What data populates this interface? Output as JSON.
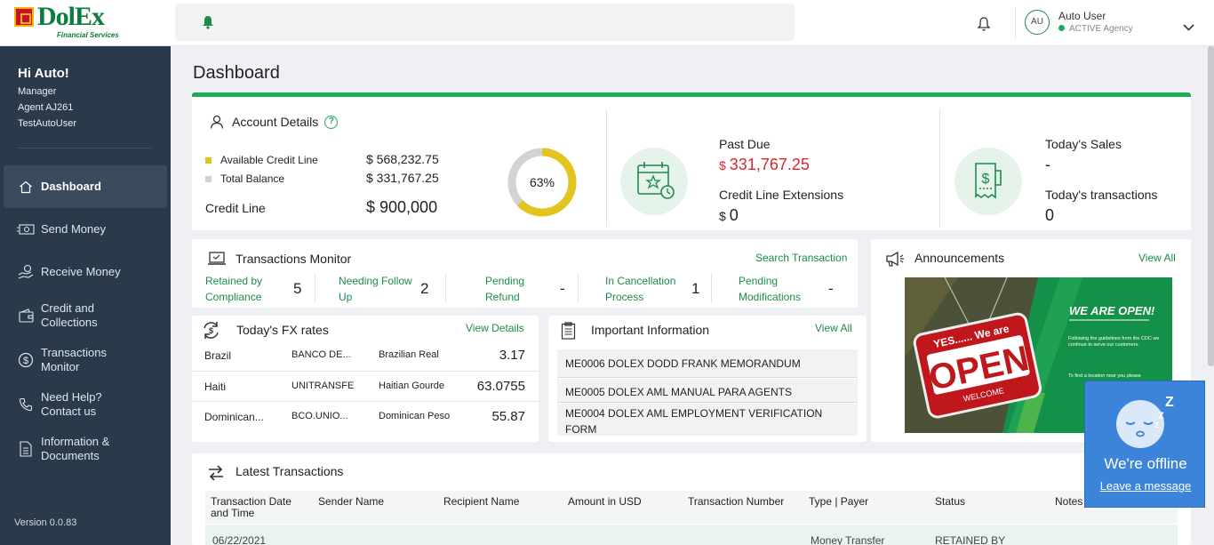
{
  "brand": {
    "name": "DolEx",
    "tagline": "Financial Services"
  },
  "user": {
    "initials": "AU",
    "name": "Auto User",
    "status": "ACTIVE Agency"
  },
  "sidebar": {
    "greeting": "Hi Auto!",
    "role": "Manager",
    "agent": "Agent AJ261",
    "username": "TestAutoUser",
    "items": [
      {
        "label": "Dashboard",
        "icon": "home-icon"
      },
      {
        "label": "Send Money",
        "icon": "money-icon"
      },
      {
        "label": "Receive Money",
        "icon": "hand-money-icon"
      },
      {
        "label": "Credit and Collections",
        "icon": "wallet-icon"
      },
      {
        "label": "Transactions Monitor",
        "icon": "dollar-circle-icon"
      },
      {
        "label": "Need Help? Contact us",
        "icon": "phone-icon"
      },
      {
        "label": "Information & Documents",
        "icon": "document-icon"
      }
    ],
    "version": "Version 0.0.83"
  },
  "page": {
    "title": "Dashboard"
  },
  "account": {
    "title": "Account Details",
    "help": "?",
    "available_label": "Available Credit Line",
    "available_value": "$ 568,232.75",
    "balance_label": "Total Balance",
    "balance_value": "$ 331,767.25",
    "credit_line_label": "Credit Line",
    "credit_line_value": "$ 900,000",
    "usage_percent": 63,
    "usage_label": "63%",
    "colors": {
      "available": "#e2c51c",
      "balance": "#d3d3d3",
      "accent": "#1faa55"
    }
  },
  "past_due": {
    "label": "Past Due",
    "currency": "$",
    "value": "331,767.25",
    "ext_label": "Credit Line Extensions",
    "ext_currency": "$",
    "ext_value": "0"
  },
  "sales": {
    "label": "Today's Sales",
    "value": "-",
    "tx_label": "Today's transactions",
    "tx_value": "0"
  },
  "transactions_monitor": {
    "title": "Transactions Monitor",
    "link": "Search Transaction",
    "items": [
      {
        "label_1": "Retained by",
        "label_2": "Compliance",
        "value": "5"
      },
      {
        "label_1": "Needing Follow",
        "label_2": "Up",
        "value": "2"
      },
      {
        "label_1": "Pending",
        "label_2": "Refund",
        "value": "-"
      },
      {
        "label_1": "In Cancellation",
        "label_2": "Process",
        "value": "1"
      },
      {
        "label_1": "Pending",
        "label_2": "Modifications",
        "value": "-"
      }
    ]
  },
  "fx": {
    "title": "Today's FX rates",
    "link": "View Details",
    "rows": [
      {
        "country": "Brazil",
        "bank": "BANCO DE...",
        "currency": "Brazilian Real",
        "rate": "3.17"
      },
      {
        "country": "Haiti",
        "bank": "UNITRANSFE",
        "currency": "Haitian Gourde",
        "rate": "63.0755"
      },
      {
        "country": "Dominican...",
        "bank": "BCO.UNIO...",
        "currency": "Dominican Peso",
        "rate": "55.87"
      }
    ]
  },
  "info": {
    "title": "Important Information",
    "link": "View All",
    "items": [
      "ME0006 DOLEX DODD FRANK MEMORANDUM",
      "ME0005 DOLEX AML MANUAL PARA AGENTS",
      "ME0004 DOLEX AML EMPLOYMENT VERIFICATION FORM"
    ]
  },
  "announcements": {
    "title": "Announcements",
    "link": "View All",
    "image": {
      "sign_top": "YES...... We are",
      "sign_main": "OPEN",
      "sign_bottom": "WELCOME",
      "headline": "WE ARE OPEN!",
      "body": "Following the guidelines from the CDC we continue to serve our customers.",
      "body2": "To find a location near you please"
    }
  },
  "latest": {
    "title": "Latest Transactions",
    "columns": [
      "Transaction Date and Time",
      "Sender Name",
      "Recipient Name",
      "Amount in USD",
      "Transaction Number",
      "Type | Payer",
      "Status",
      "Notes"
    ],
    "row": {
      "date": "06/22/2021",
      "type": "Money Transfer",
      "status": "RETAINED BY"
    }
  },
  "chat": {
    "status": "We're offline",
    "link": "Leave a message"
  }
}
